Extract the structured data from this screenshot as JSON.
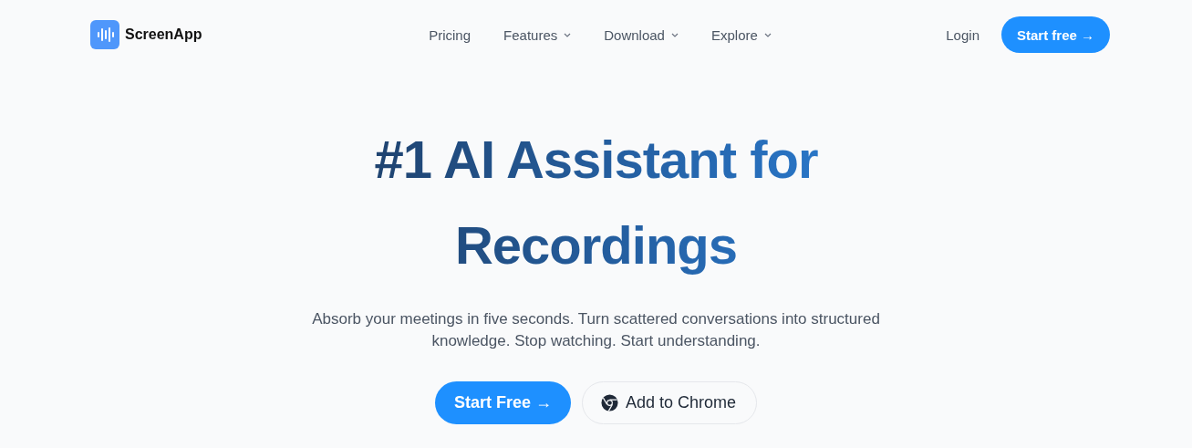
{
  "header": {
    "logo_text": "ScreenApp",
    "nav": [
      {
        "label": "Pricing",
        "has_menu": false
      },
      {
        "label": "Features",
        "has_menu": true
      },
      {
        "label": "Download",
        "has_menu": true
      },
      {
        "label": "Explore",
        "has_menu": true
      }
    ],
    "login": "Login",
    "cta": "Start free →"
  },
  "hero": {
    "title": "#1 AI Assistant for Recordings",
    "subtitle": "Absorb your meetings in five seconds. Turn scattered conversations into structured knowledge. Stop watching. Start understanding.",
    "buttons": [
      {
        "label": "Start Free →",
        "kind": "primary"
      },
      {
        "label": "Add to Chrome",
        "kind": "chrome"
      }
    ]
  }
}
